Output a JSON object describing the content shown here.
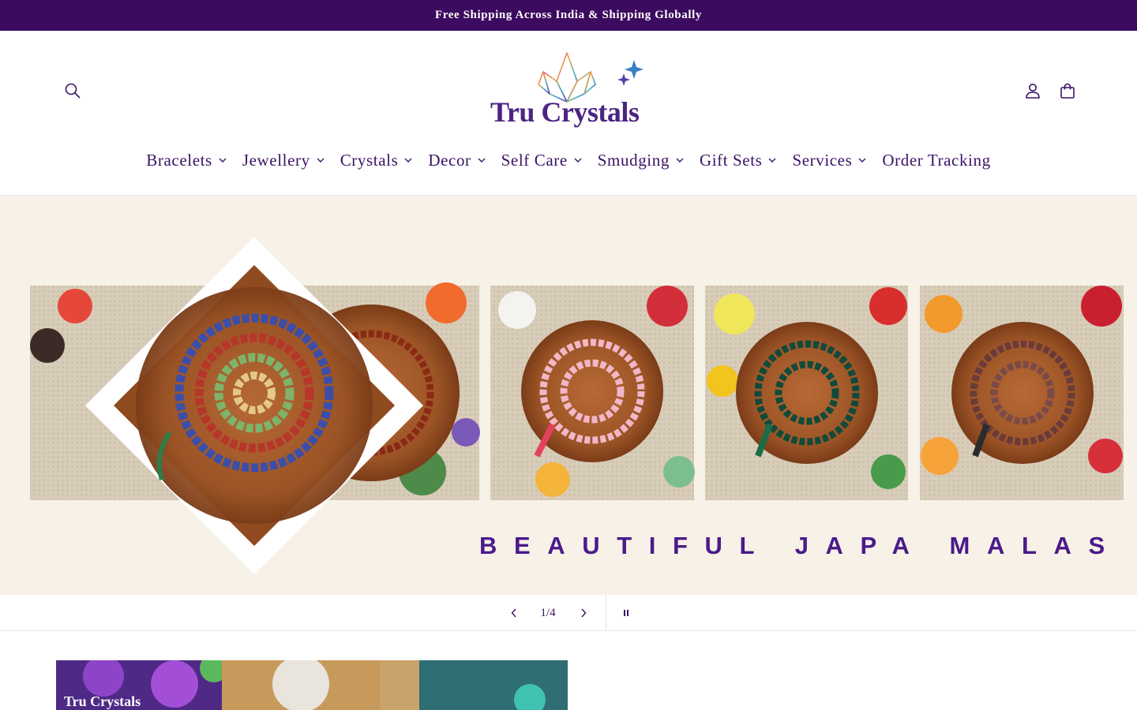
{
  "announcement": {
    "text": "Free Shipping Across India & Shipping Globally"
  },
  "header": {
    "brand_name": "Tru Crystals",
    "icons": {
      "search": "search-icon",
      "account": "user-icon",
      "cart": "bag-icon"
    }
  },
  "nav": {
    "items": [
      {
        "label": "Bracelets",
        "has_dropdown": true
      },
      {
        "label": "Jewellery",
        "has_dropdown": true
      },
      {
        "label": "Crystals",
        "has_dropdown": true
      },
      {
        "label": "Decor",
        "has_dropdown": true
      },
      {
        "label": "Self Care",
        "has_dropdown": true
      },
      {
        "label": "Smudging",
        "has_dropdown": true
      },
      {
        "label": "Gift Sets",
        "has_dropdown": true
      },
      {
        "label": "Services",
        "has_dropdown": true
      },
      {
        "label": "Order Tracking",
        "has_dropdown": false
      }
    ]
  },
  "hero": {
    "caption": "BEAUTIFUL JAPA MALAS",
    "slide_counter": "1/4",
    "current_slide": 1,
    "total_slides": 4
  },
  "promo": {
    "brand_text": "Tru Crystals"
  },
  "colors": {
    "announcement_bg": "#3c0a5e",
    "brand_purple": "#3a1266",
    "hero_bg": "#f7f1e7",
    "caption_purple": "#4b1a8a"
  }
}
